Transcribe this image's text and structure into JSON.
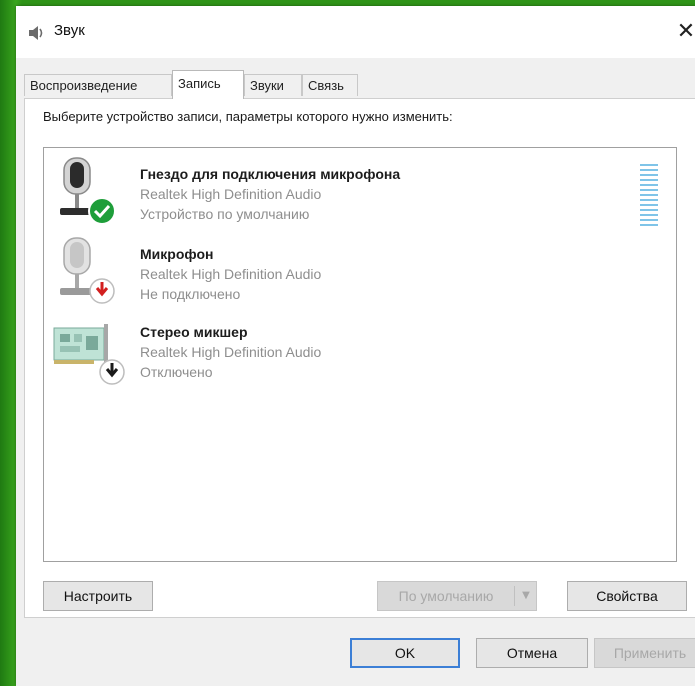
{
  "window": {
    "title": "Звук",
    "close_glyph": "✕",
    "icon": "speaker-icon"
  },
  "tabs": [
    {
      "label": "Воспроизведение",
      "active": false
    },
    {
      "label": "Запись",
      "active": true
    },
    {
      "label": "Звуки",
      "active": false
    },
    {
      "label": "Связь",
      "active": false
    }
  ],
  "instruction": "Выберите устройство записи, параметры которого нужно изменить:",
  "devices": [
    {
      "name": "Гнездо для подключения микрофона",
      "driver": "Realtek High Definition Audio",
      "status": "Устройство по умолчанию",
      "icon": "microphone-icon",
      "badge": "default-check-icon"
    },
    {
      "name": "Микрофон",
      "driver": "Realtek High Definition Audio",
      "status": "Не подключено",
      "icon": "microphone-icon",
      "badge": "disconnected-arrow-icon"
    },
    {
      "name": "Стерео микшер",
      "driver": "Realtek High Definition Audio",
      "status": "Отключено",
      "icon": "sound-card-icon",
      "badge": "disabled-arrow-icon"
    }
  ],
  "buttons": {
    "configure": "Настроить",
    "set_default": "По умолчанию",
    "set_default_arrow": "▼",
    "properties": "Свойства",
    "ok": "OK",
    "cancel": "Отмена",
    "apply": "Применить"
  },
  "colors": {
    "accent": "#3c7fd6",
    "check_badge": "#1e9e3a",
    "disconnected_badge": "#d21f1f",
    "meter": "#7fc4e8"
  }
}
